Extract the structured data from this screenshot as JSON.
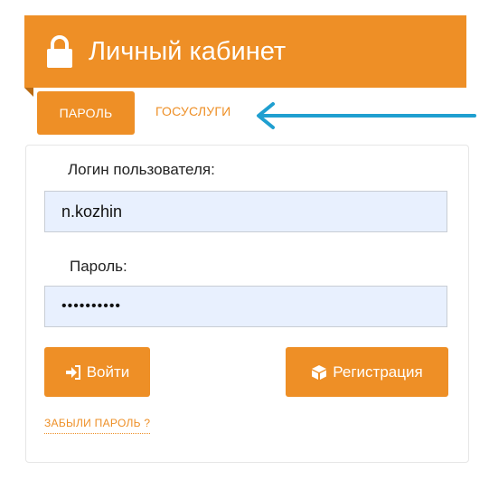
{
  "header": {
    "title": "Личный кабинет",
    "icon": "lock-icon"
  },
  "tabs": [
    {
      "label": "ПАРОЛЬ",
      "active": true
    },
    {
      "label": "ГОСУСЛУГИ",
      "active": false
    }
  ],
  "form": {
    "login_label": "Логин пользователя:",
    "login_value": "n.kozhin",
    "password_label": "Пароль:",
    "password_value": "••••••••••"
  },
  "buttons": {
    "login": "Войти",
    "register": "Регистрация"
  },
  "forgot_link": "ЗАБЫЛИ ПАРОЛЬ ?",
  "colors": {
    "accent": "#ee8f26",
    "arrow": "#1f9fd0",
    "input_bg": "#e8f0fe"
  }
}
